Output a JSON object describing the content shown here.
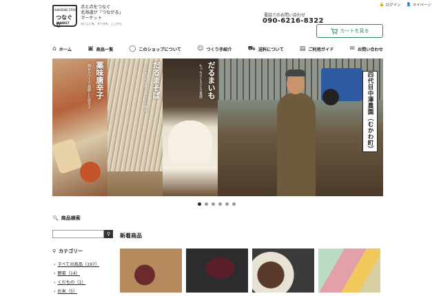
{
  "header": {
    "logo_top": "SHIKIDAKE STORE",
    "logo_main": "つなぐな",
    "logo_bottom": "MARKET",
    "tagline": [
      "点と点をつなぐ",
      "北海道が「つながる」",
      "マーケット"
    ],
    "tagline_sub": "おいしいを、すてきを、ここから",
    "login": "ログイン",
    "mypage": "マイページ",
    "tel_label": "電話でのお問い合わせ",
    "tel": "090-6216-8322",
    "cart": "カートを見る"
  },
  "nav": [
    {
      "label": "ホーム",
      "icon": "home-icon"
    },
    {
      "label": "商品一覧",
      "icon": "gift-icon"
    },
    {
      "label": "このショップについて",
      "icon": "chat-icon"
    },
    {
      "label": "つくり手紹介",
      "icon": "person-icon"
    },
    {
      "label": "送料について",
      "icon": "truck-icon"
    },
    {
      "label": "ご利用ガイド",
      "icon": "book-icon"
    },
    {
      "label": "お問い合わせ",
      "icon": "mail-icon"
    }
  ],
  "hero": {
    "p1_title": "薬味唐辛子",
    "p1_sub": "麹をかけてで発酵した唐辛子",
    "p2_title": "だるまそば",
    "p2_sub": "だるまいもを練り込んだお蕎麦",
    "p3_title": "だるまいも",
    "p3_sub": "もっちりとろとろ食感",
    "farm_label": "四代目中澤農園（むかわ町）"
  },
  "slider": {
    "active": 0,
    "count": 6
  },
  "sidebar": {
    "search_title": "商品検索",
    "search_placeholder": "",
    "category_title": "カテゴリー",
    "categories": [
      {
        "label": "すべての商品（197）"
      },
      {
        "label": "野菜（14）"
      },
      {
        "label": "くだもの（1）"
      },
      {
        "label": "お米（5）"
      }
    ]
  },
  "main": {
    "new_title": "新着商品"
  },
  "colors": {
    "accent": "#2c8a57"
  }
}
